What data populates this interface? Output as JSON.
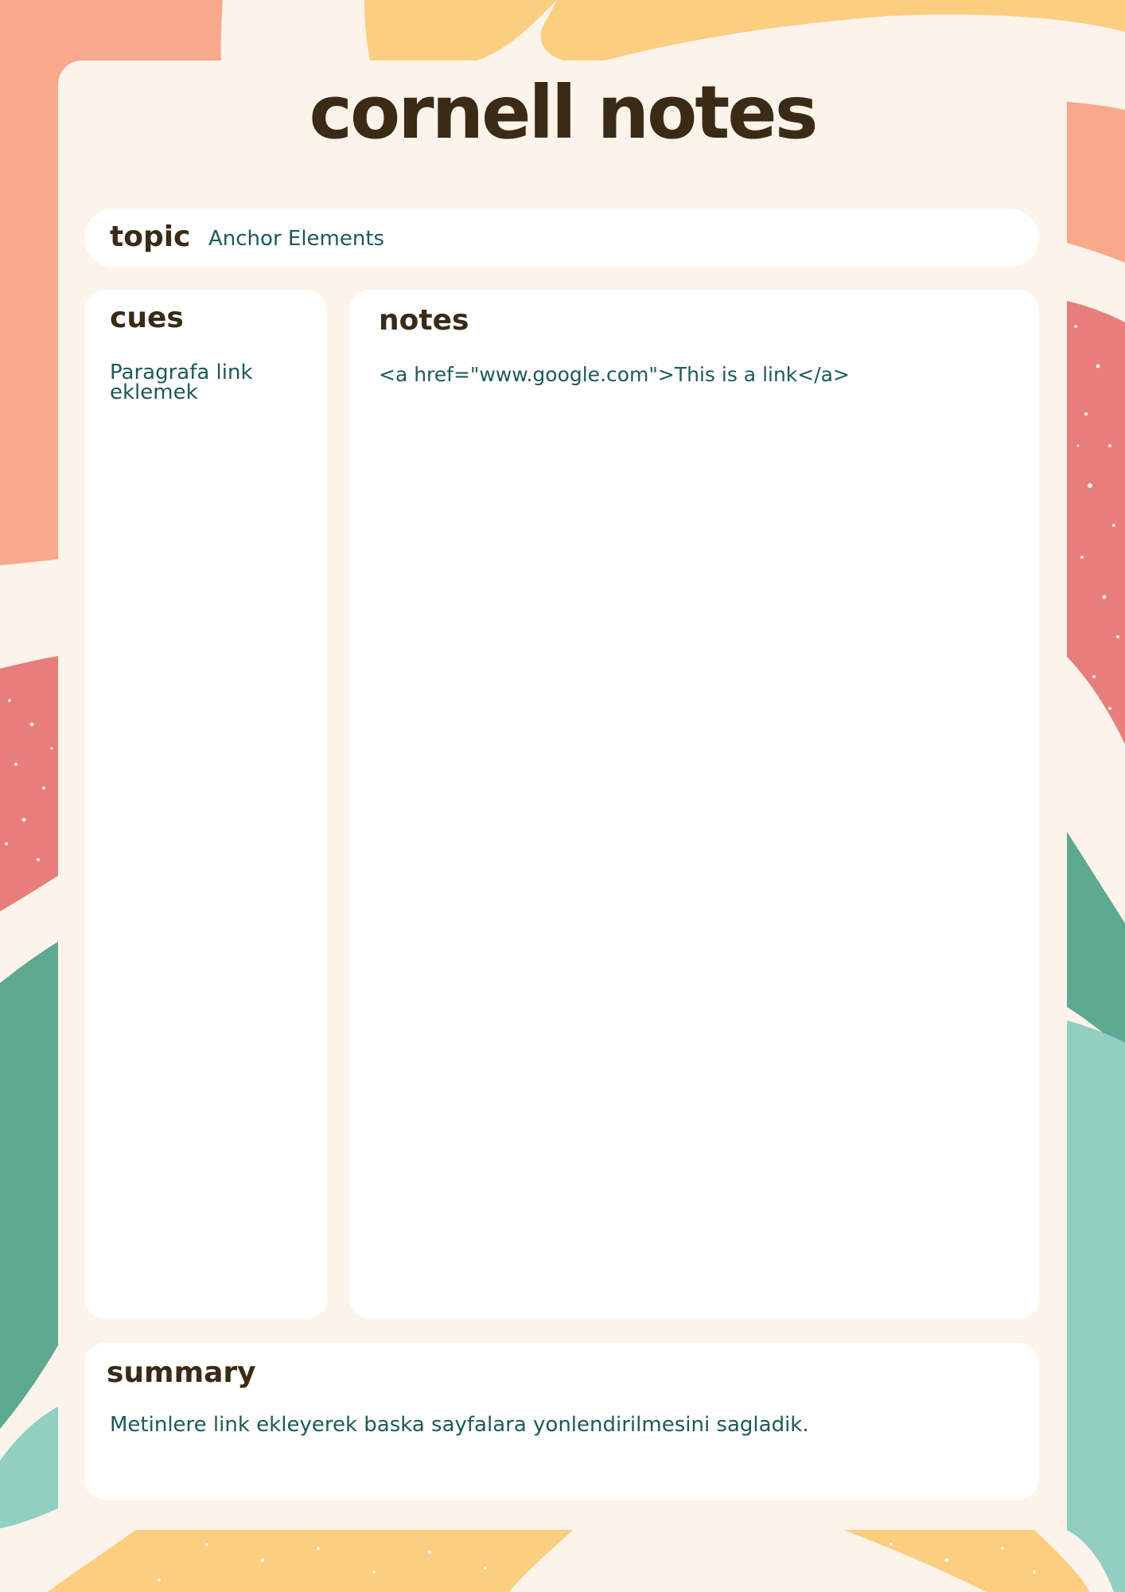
{
  "title": "cornell notes",
  "topic": {
    "label": "topic",
    "value": "Anchor Elements"
  },
  "cues": {
    "label": "cues",
    "lines": [
      "Paragrafa link",
      "eklemek"
    ]
  },
  "notes": {
    "label": "notes",
    "text": "<a href=\"www.google.com\">This is a link</a>"
  },
  "summary": {
    "label": "summary",
    "text": "Metinlere link ekleyerek baska sayfalara yonlendirilmesini sagladik."
  },
  "colors": {
    "page_background": "#FCF3EA",
    "heading": "#3A2A16",
    "body_text": "#1C5A57",
    "salmon": "#F9A88C",
    "yellow": "#FDCD80",
    "coral": "#E77E7B",
    "green": "#5EA990",
    "mint": "#90CFC2"
  }
}
